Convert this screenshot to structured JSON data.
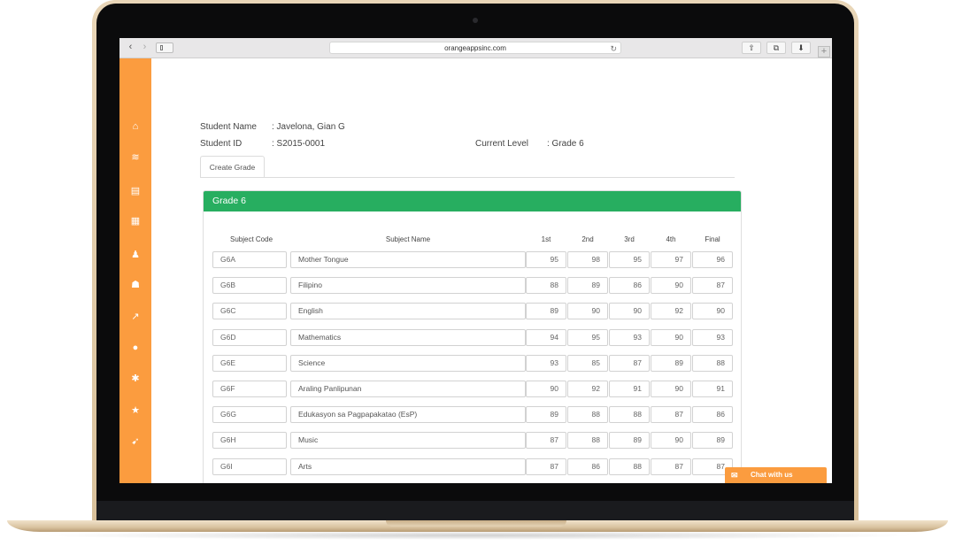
{
  "browser": {
    "url": "orangeappsinc.com",
    "back_glyph": "‹",
    "forward_glyph": "›",
    "reload_glyph": "↻",
    "share_glyph": "⇧",
    "tabs_glyph": "⧉",
    "download_glyph": "⬇",
    "plus_glyph": "+"
  },
  "sidebar": {
    "icons": [
      {
        "name": "home-icon",
        "glyph": "⌂"
      },
      {
        "name": "layers-icon",
        "glyph": "≋"
      },
      {
        "name": "document-icon",
        "glyph": "▤"
      },
      {
        "name": "calendar-icon",
        "glyph": "▦"
      },
      {
        "name": "graduate-icon",
        "glyph": "♟"
      },
      {
        "name": "users-icon",
        "glyph": "☗"
      },
      {
        "name": "chart-icon",
        "glyph": "↗"
      },
      {
        "name": "head-icon",
        "glyph": "●"
      },
      {
        "name": "gear-icon",
        "glyph": "✱"
      },
      {
        "name": "star-icon",
        "glyph": "★"
      },
      {
        "name": "rocket-icon",
        "glyph": "➹"
      }
    ]
  },
  "student": {
    "name_label": "Student Name",
    "name_value": ": Javelona, Gian G",
    "id_label": "Student ID",
    "id_value": ": S2015-0001",
    "level_label": "Current Level",
    "level_value": ": Grade 6"
  },
  "tab": {
    "label": "Create Grade"
  },
  "panel": {
    "title": "Grade 6",
    "headers": {
      "code": "Subject Code",
      "name": "Subject Name",
      "q1": "1st",
      "q2": "2nd",
      "q3": "3rd",
      "q4": "4th",
      "final": "Final"
    },
    "rows": [
      {
        "code": "G6A",
        "name": "Mother Tongue",
        "q1": "95",
        "q2": "98",
        "q3": "95",
        "q4": "97",
        "final": "96"
      },
      {
        "code": "G6B",
        "name": "Filipino",
        "q1": "88",
        "q2": "89",
        "q3": "86",
        "q4": "90",
        "final": "87"
      },
      {
        "code": "G6C",
        "name": "English",
        "q1": "89",
        "q2": "90",
        "q3": "90",
        "q4": "92",
        "final": "90"
      },
      {
        "code": "G6D",
        "name": "Mathematics",
        "q1": "94",
        "q2": "95",
        "q3": "93",
        "q4": "90",
        "final": "93"
      },
      {
        "code": "G6E",
        "name": "Science",
        "q1": "93",
        "q2": "85",
        "q3": "87",
        "q4": "89",
        "final": "88"
      },
      {
        "code": "G6F",
        "name": "Araling Panlipunan",
        "q1": "90",
        "q2": "92",
        "q3": "91",
        "q4": "90",
        "final": "91"
      },
      {
        "code": "G6G",
        "name": "Edukasyon sa Pagpapakatao (EsP)",
        "q1": "89",
        "q2": "88",
        "q3": "88",
        "q4": "87",
        "final": "86"
      },
      {
        "code": "G6H",
        "name": "Music",
        "q1": "87",
        "q2": "88",
        "q3": "89",
        "q4": "90",
        "final": "89"
      },
      {
        "code": "G6I",
        "name": "Arts",
        "q1": "87",
        "q2": "86",
        "q3": "88",
        "q4": "87",
        "final": "87"
      }
    ]
  },
  "chat": {
    "label": "Chat with us",
    "icon_glyph": "✉"
  },
  "colors": {
    "accent_orange": "#fb9c3f",
    "panel_green": "#27ae60",
    "laptop_gold": "#e0cba8"
  }
}
